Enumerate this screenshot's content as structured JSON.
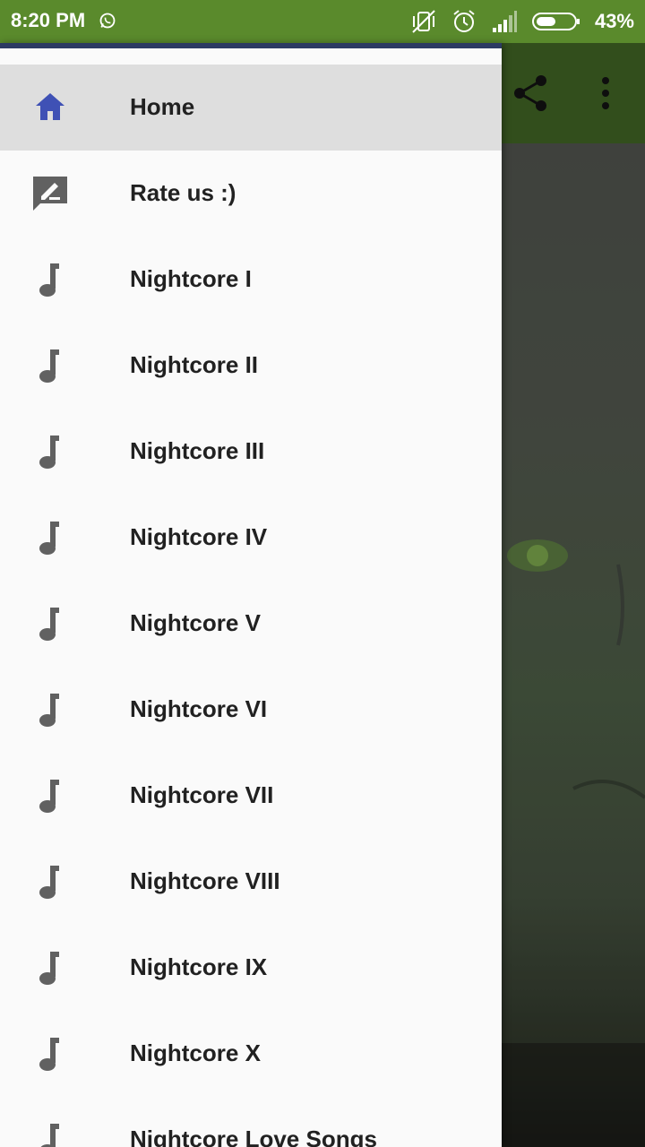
{
  "status_bar": {
    "time": "8:20 PM",
    "battery": "43%",
    "icons": [
      "whatsapp-icon",
      "vibrate-off-icon",
      "alarm-icon",
      "signal-icon",
      "battery-icon"
    ]
  },
  "toolbar": {
    "actions": [
      "share-icon",
      "more-vert-icon"
    ],
    "color": "#3b5c22"
  },
  "drawer": {
    "items": [
      {
        "label": "Home",
        "icon": "home-icon",
        "active": true
      },
      {
        "label": "Rate us :)",
        "icon": "rate-review-icon"
      },
      {
        "label": "Nightcore I",
        "icon": "music-note-icon"
      },
      {
        "label": "Nightcore II",
        "icon": "music-note-icon"
      },
      {
        "label": "Nightcore III",
        "icon": "music-note-icon"
      },
      {
        "label": "Nightcore IV",
        "icon": "music-note-icon"
      },
      {
        "label": "Nightcore V",
        "icon": "music-note-icon"
      },
      {
        "label": "Nightcore VI",
        "icon": "music-note-icon"
      },
      {
        "label": "Nightcore VII",
        "icon": "music-note-icon"
      },
      {
        "label": "Nightcore VIII",
        "icon": "music-note-icon"
      },
      {
        "label": "Nightcore IX",
        "icon": "music-note-icon"
      },
      {
        "label": "Nightcore X",
        "icon": "music-note-icon"
      },
      {
        "label": "Nightcore Love Songs",
        "icon": "music-note-icon"
      }
    ]
  },
  "colors": {
    "status_bar": "#5a8a2c",
    "active_icon": "#3f51b5",
    "icon": "#616161",
    "active_background": "#dedede"
  }
}
